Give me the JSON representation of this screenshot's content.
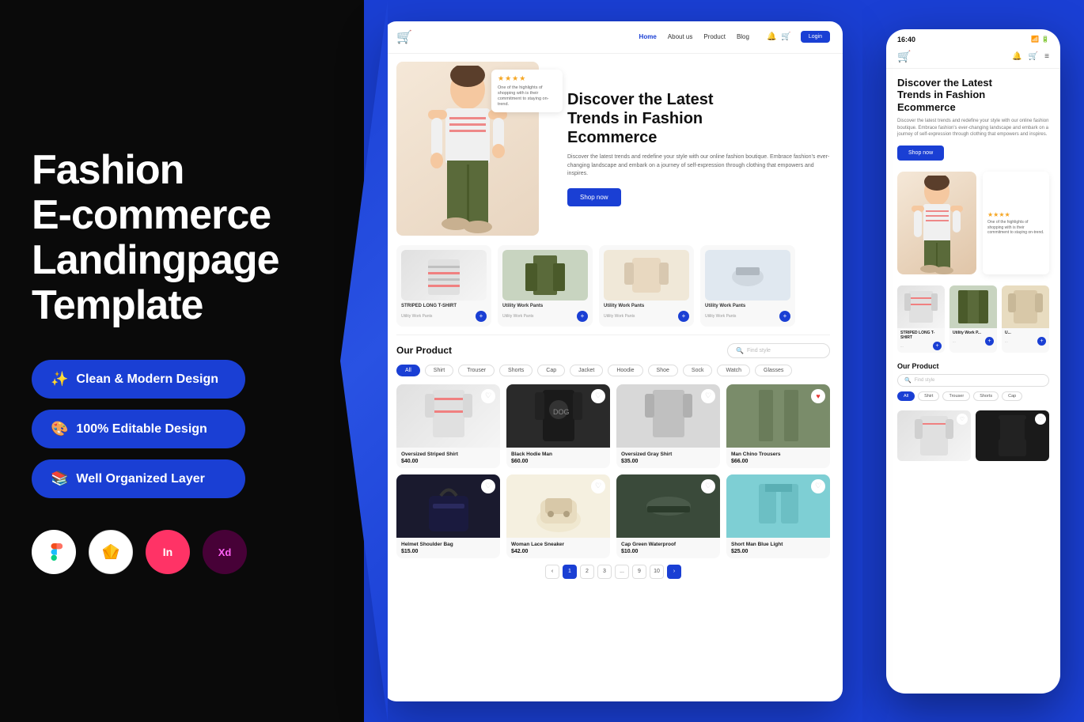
{
  "left": {
    "title": "Fashion\nE-commerce\nLandingpage\nTemplate",
    "badges": [
      {
        "id": "clean-design",
        "icon": "✨",
        "label": "Clean & Modern  Design"
      },
      {
        "id": "editable",
        "icon": "🎨",
        "label": "100% Editable Design"
      },
      {
        "id": "layer",
        "icon": "📚",
        "label": "Well Organized Layer"
      }
    ],
    "tools": [
      {
        "id": "figma",
        "label": "F",
        "title": "Figma"
      },
      {
        "id": "sketch",
        "label": "S",
        "title": "Sketch"
      },
      {
        "id": "invision",
        "label": "In",
        "title": "InVision"
      },
      {
        "id": "xd",
        "label": "Xd",
        "title": "Adobe XD"
      }
    ]
  },
  "desktop": {
    "nav": {
      "links": [
        "Home",
        "About us",
        "Product",
        "Blog"
      ],
      "login": "Login"
    },
    "hero": {
      "title": "Discover the Latest\nTrends in Fashion\nEcommerce",
      "description": "Discover the latest trends and redefine your style with our online fashion boutique. Embrace fashion's ever-changing landscape and embark on a journey of self-expression through clothing that empowers and inspires.",
      "cta": "Shop now",
      "review": {
        "stars": "★★★★",
        "text": "One of the highlights of shopping with is their commitment to staying on-trend."
      }
    },
    "thumbnails": [
      {
        "label": "STRIPED LONG T-SHIRT",
        "sub": "Utility Work Pants"
      },
      {
        "label": "Utility Work Pants",
        "sub": "Utility Work Pants"
      },
      {
        "label": "Utility Work Pants",
        "sub": "Utility Work Pants"
      },
      {
        "label": "Utility Work Pants",
        "sub": "Utility Work Pants"
      }
    ],
    "products_section": {
      "title": "Our Product",
      "search_placeholder": "Find style",
      "categories": [
        "All",
        "Shirt",
        "Trouser",
        "Shorts",
        "Cap",
        "Jacket",
        "Hoodie",
        "Shoe",
        "Sock",
        "Watch",
        "Glasses"
      ],
      "active_category": "All",
      "items": [
        {
          "name": "Oversized Striped Shirt",
          "price": "$40.00",
          "liked": false
        },
        {
          "name": "Black Hodie Man",
          "price": "$60.00",
          "liked": false
        },
        {
          "name": "Oversized Gray Shirt",
          "price": "$35.00",
          "liked": false
        },
        {
          "name": "Man Chino Trousers",
          "price": "$66.00",
          "liked": true
        },
        {
          "name": "Helmet Shoulder Bag",
          "price": "$15.00",
          "liked": false
        },
        {
          "name": "Woman Lace Sneaker",
          "price": "$42.00",
          "liked": false
        },
        {
          "name": "Cap Green Waterproof",
          "price": "$10.00",
          "liked": false
        },
        {
          "name": "Short Man Blue Light",
          "price": "$25.00",
          "liked": false
        }
      ]
    },
    "pagination": {
      "pages": [
        "1",
        "2",
        "3",
        "...",
        "9",
        "10"
      ],
      "active": "1"
    }
  },
  "mobile": {
    "time": "16:40",
    "hero": {
      "title": "Discover the Latest\nTrends in Fashion\nEcommerce",
      "description": "Discover the latest trends and redefine your style with our online fashion boutique. Embrace fashion's ever-changing landscape and embark on a journey of self-expression through clothing that empowers and inspires.",
      "cta": "Shop now"
    },
    "review": {
      "stars": "★★★★",
      "text": "One of the highlights of shopping with is their commitment to staying on-trend."
    },
    "thumbs": [
      {
        "label": "STRIPED LONG T-SHIRT",
        "sub": "..."
      },
      {
        "label": "Utility Work P...",
        "sub": "..."
      }
    ],
    "products_section": {
      "title": "Our Product",
      "search_placeholder": "Find style",
      "categories": [
        "All",
        "Shirt",
        "Trouser",
        "Shorts",
        "Cap"
      ]
    }
  }
}
